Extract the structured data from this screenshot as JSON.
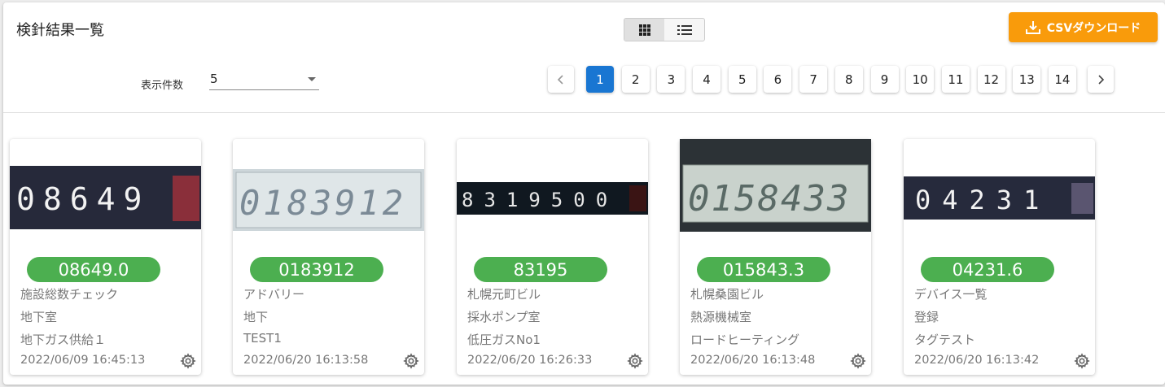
{
  "header": {
    "title": "検針結果一覧",
    "csv_label": "CSVダウンロード"
  },
  "view_toggle": {
    "active": "grid"
  },
  "perpage": {
    "label": "表示件数",
    "value": "5"
  },
  "pagination": {
    "prev": "‹",
    "next": "›",
    "active": 1,
    "pages": [
      "1",
      "2",
      "3",
      "4",
      "5",
      "6",
      "7",
      "8",
      "9",
      "10",
      "11",
      "12",
      "13",
      "14"
    ]
  },
  "colors": {
    "accent": "#f99b0b",
    "primary": "#1976d2",
    "badge": "#4caf50"
  },
  "cards": [
    {
      "reading": "08649.0",
      "building": "施設総数チェック",
      "location": "地下室",
      "name": "地下ガス供給１",
      "timestamp": "2022/06/09 16:45:13",
      "digits": "08649"
    },
    {
      "reading": "0183912",
      "building": "アドバリー",
      "location": "地下",
      "name": "TEST1",
      "timestamp": "2022/06/20 16:13:58",
      "digits": "0183912"
    },
    {
      "reading": "83195",
      "building": "札幌元町ビル",
      "location": "採水ポンプ室",
      "name": "低圧ガスNo1",
      "timestamp": "2022/06/20 16:26:33",
      "digits": "8319500"
    },
    {
      "reading": "015843.3",
      "building": "札幌桑園ビル",
      "location": "熱源機械室",
      "name": "ロードヒーティング",
      "timestamp": "2022/06/20 16:13:48",
      "digits": "0158433"
    },
    {
      "reading": "04231.6",
      "building": "デバイス一覧",
      "location": "登録",
      "name": "タグテスト",
      "timestamp": "2022/06/20 16:13:42",
      "digits": "04231"
    }
  ]
}
